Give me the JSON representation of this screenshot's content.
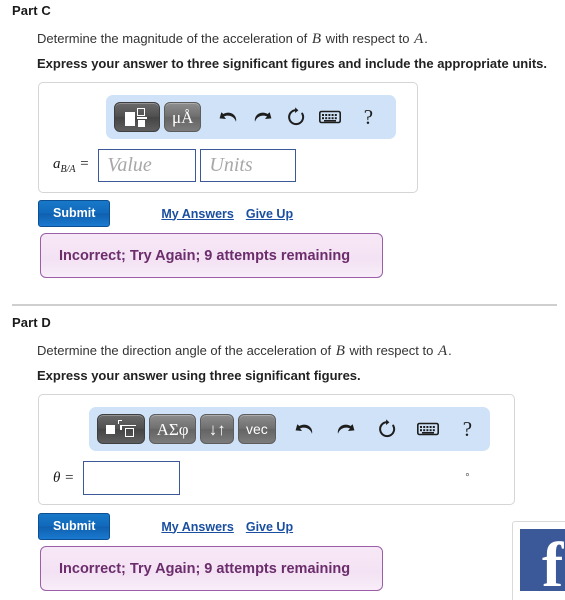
{
  "parts": [
    {
      "title": "Part C",
      "question_prefix": "Determine the magnitude of the acceleration of ",
      "question_var1": "B",
      "question_middle": " with respect to ",
      "question_var2": "A",
      "question_suffix": ".",
      "instruction": "Express your answer to three significant figures and include the appropriate units.",
      "toolbar": {
        "template_button": "template-icon",
        "units_button": "μÅ",
        "undo": "undo-icon",
        "redo": "redo-icon",
        "reset": "reset-icon",
        "keyboard": "keyboard-icon",
        "help": "?"
      },
      "answer_label_main": "a",
      "answer_label_sub": "B/A",
      "answer_label_eq": " =",
      "value_placeholder": "Value",
      "value_current": "",
      "units_placeholder": "Units",
      "units_current": "",
      "submit_label": "Submit",
      "my_answers_label": "My Answers",
      "give_up_label": "Give Up",
      "feedback": "Incorrect; Try Again; 9 attempts remaining"
    },
    {
      "title": "Part D",
      "question_prefix": "Determine the direction angle of the acceleration of ",
      "question_var1": "B",
      "question_middle": " with respect to ",
      "question_var2": "A",
      "question_suffix": ".",
      "instruction": "Express your answer using three significant figures.",
      "toolbar": {
        "template_button": "sqrt-template-icon",
        "greek_button": "ΑΣφ",
        "arrows_button": "↓↑",
        "vec_button": "vec",
        "undo": "undo-icon",
        "redo": "redo-icon",
        "reset": "reset-icon",
        "keyboard": "keyboard-icon",
        "help": "?"
      },
      "answer_label_main": "θ",
      "answer_label_eq": " =",
      "value_placeholder": "",
      "value_current": "",
      "unit_suffix": "°",
      "submit_label": "Submit",
      "my_answers_label": "My Answers",
      "give_up_label": "Give Up",
      "feedback": "Incorrect; Try Again; 9 attempts remaining"
    }
  ],
  "facebook_widget": {
    "logo_letter": "f",
    "brand_color": "#3b5998"
  },
  "colors": {
    "toolbar_bg": "#cfe2f7",
    "submit_blue": "#1169bb",
    "link_blue": "#1a4fa0",
    "feedback_border": "#9b5fa8",
    "feedback_text": "#6b2d6b",
    "field_border": "#3b5998"
  }
}
